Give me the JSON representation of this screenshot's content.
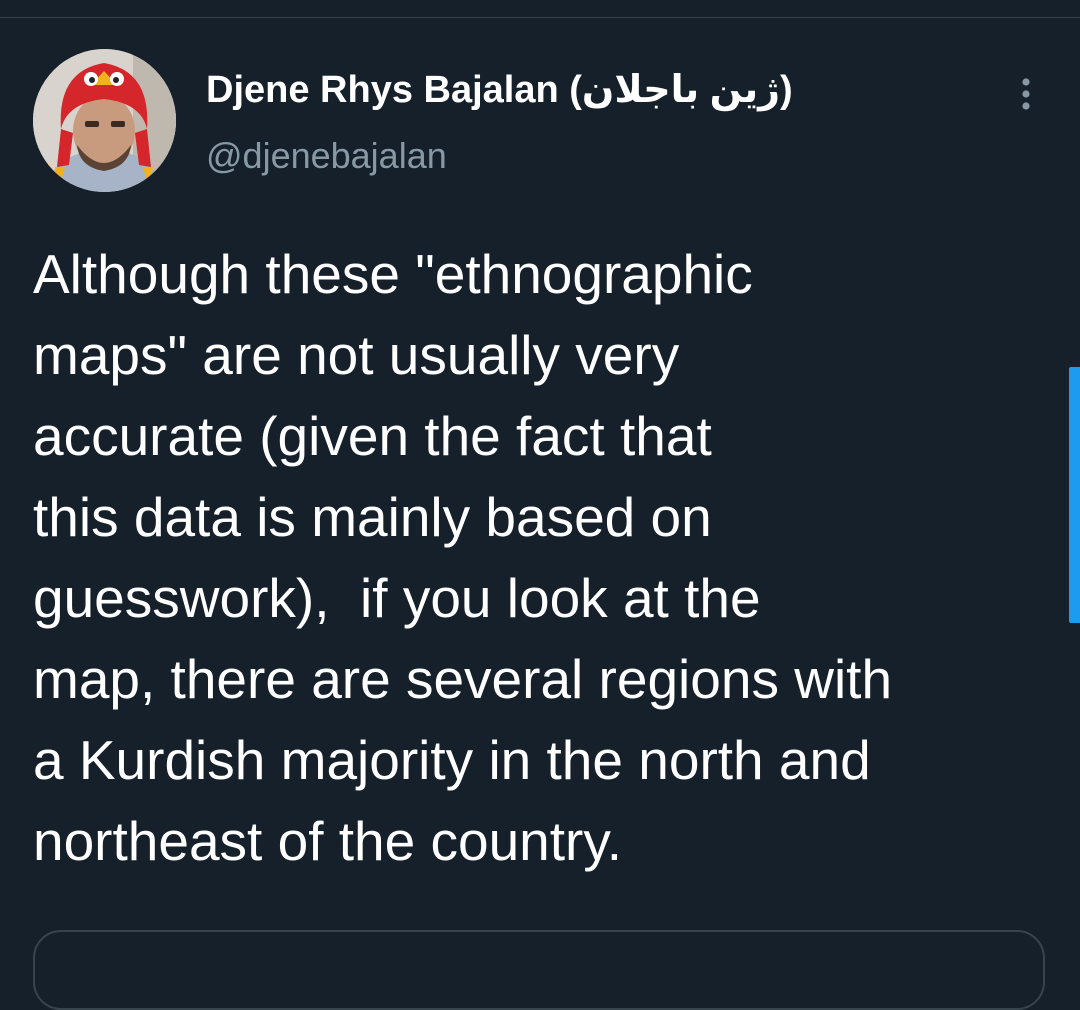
{
  "author": {
    "display_name": "Djene Rhys Bajalan (ژین باجلان)",
    "handle": "@djenebajalan"
  },
  "tweet": {
    "lines": [
      "Although these \"ethnographic",
      "maps\" are not usually very",
      "accurate (given the fact that",
      "this data is mainly based on",
      "guesswork),  if you look at the",
      "map, there are several regions with",
      "a Kurdish majority in the north and",
      "northeast of the country."
    ]
  },
  "icons": {
    "more": "vertical-ellipsis-icon"
  },
  "colors": {
    "background": "#15202b",
    "text": "#ffffff",
    "secondary_text": "#8899a6",
    "divider": "#38444d",
    "accent": "#1d9bf0"
  }
}
